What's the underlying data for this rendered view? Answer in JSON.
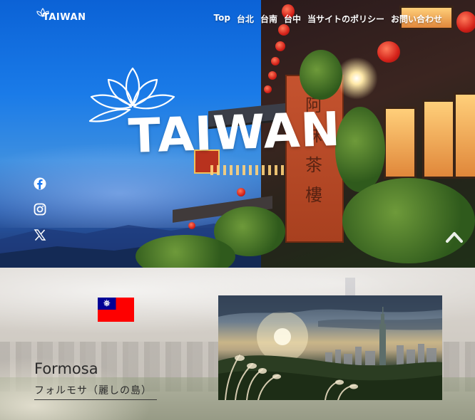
{
  "header": {
    "logo_text": "TAIWAN",
    "nav": [
      {
        "label": "Top"
      },
      {
        "label": "台北"
      },
      {
        "label": "台南"
      },
      {
        "label": "台中"
      },
      {
        "label": "当サイトのポリシー"
      },
      {
        "label": "お問い合わせ"
      }
    ]
  },
  "hero": {
    "title": "TAIWAN",
    "banner_text": "阿妹茶樓"
  },
  "social": [
    {
      "icon": "facebook-icon",
      "color": "#ffffff"
    },
    {
      "icon": "instagram-icon",
      "color": "#ffffff"
    },
    {
      "icon": "x-icon",
      "color": "#ffffff"
    }
  ],
  "formosa": {
    "title": "Formosa",
    "subtitle": "フォルモサ（麗しの島）"
  },
  "colors": {
    "sky": "#1a7be8",
    "flag_red": "#fe0000",
    "flag_blue": "#000095",
    "text_dark": "#2b2b2b"
  }
}
